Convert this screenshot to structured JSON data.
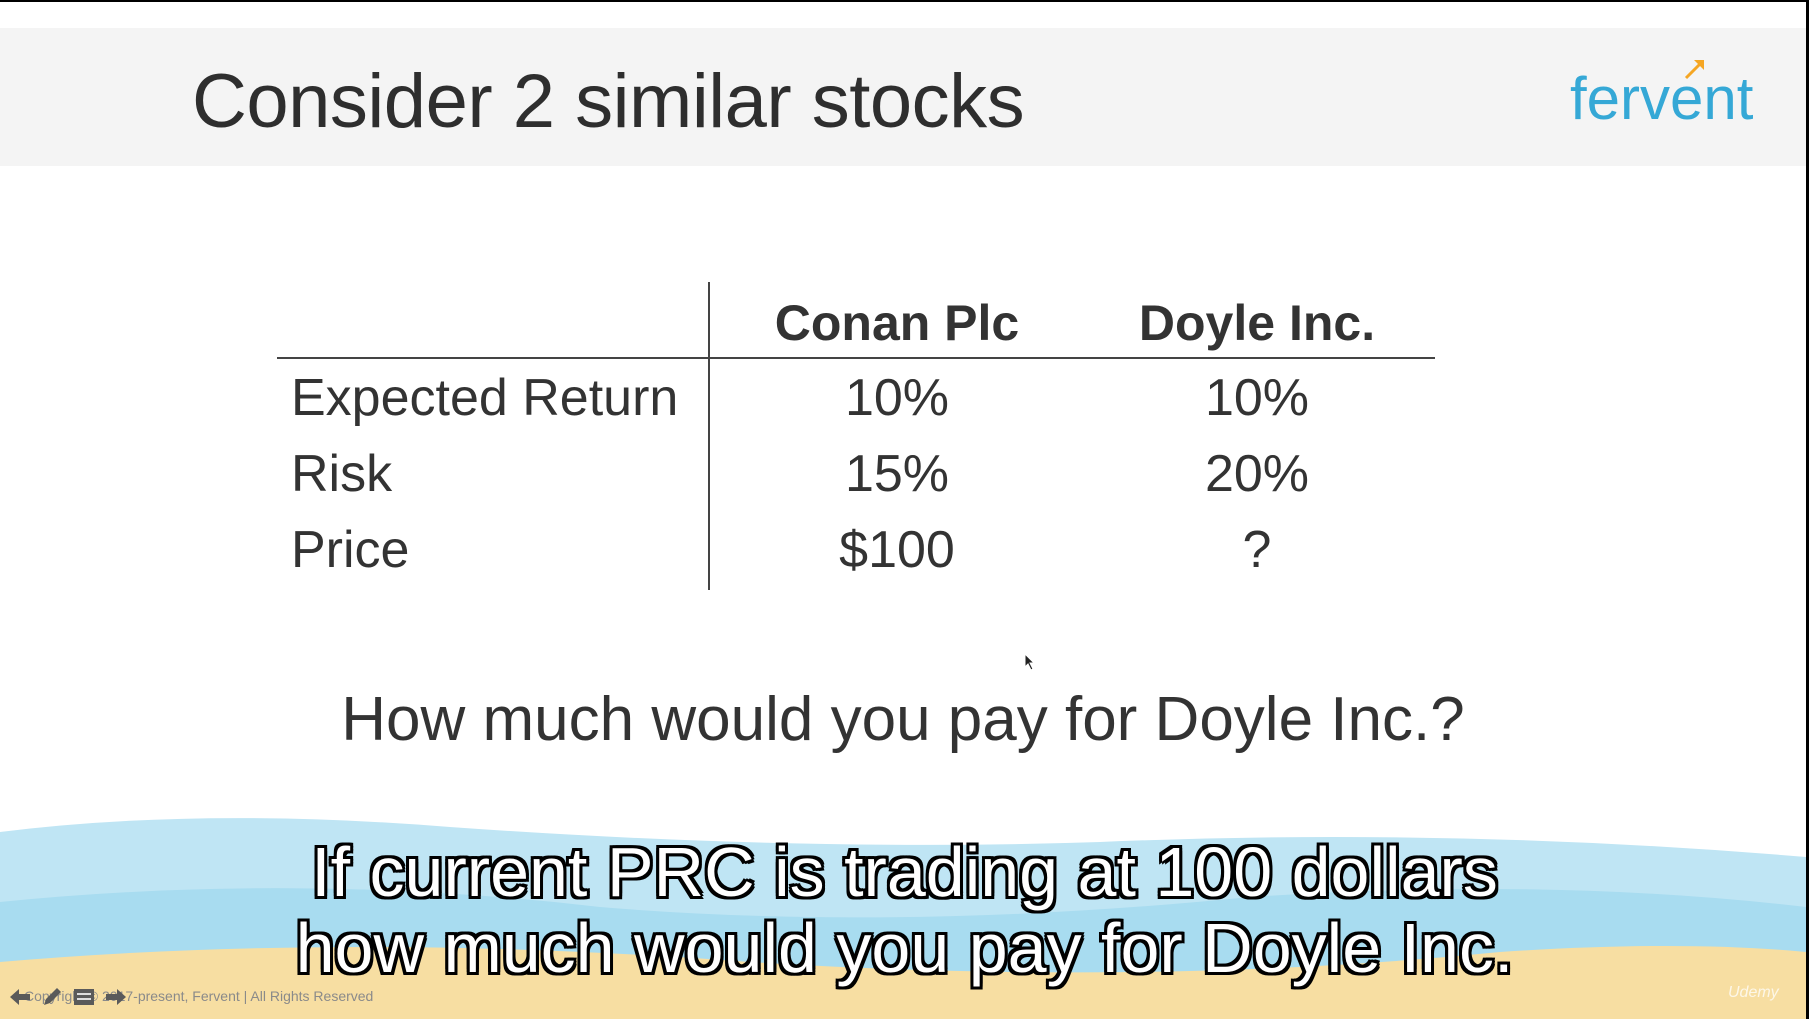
{
  "slide": {
    "title": "Consider 2 similar stocks",
    "logo_text": "fervent",
    "question": "How much would you pay for Doyle Inc.?"
  },
  "table": {
    "columns": [
      "Conan Plc",
      "Doyle Inc."
    ],
    "rows": [
      {
        "label": "Expected Return",
        "values": [
          "10%",
          "10%"
        ]
      },
      {
        "label": "Risk",
        "values": [
          "15%",
          "20%"
        ]
      },
      {
        "label": "Price",
        "values": [
          "$100",
          "?"
        ]
      }
    ]
  },
  "subtitles": {
    "line1": "If current PRC is trading at 100 dollars",
    "line2": "how much would you pay for Doyle Inc."
  },
  "footer": {
    "copyright": "Copyright © 2017-present, Fervent | All Rights Reserved",
    "watermark": "Udemy"
  },
  "colors": {
    "logo": "#35a8d6",
    "logo_arrow": "#f5a623",
    "wave_blue": "#bfe5f4",
    "sand": "#f7dea2"
  },
  "icons": [
    "back-arrow-icon",
    "pen-icon",
    "slides-icon",
    "forward-arrow-icon",
    "mouse-cursor-icon"
  ]
}
